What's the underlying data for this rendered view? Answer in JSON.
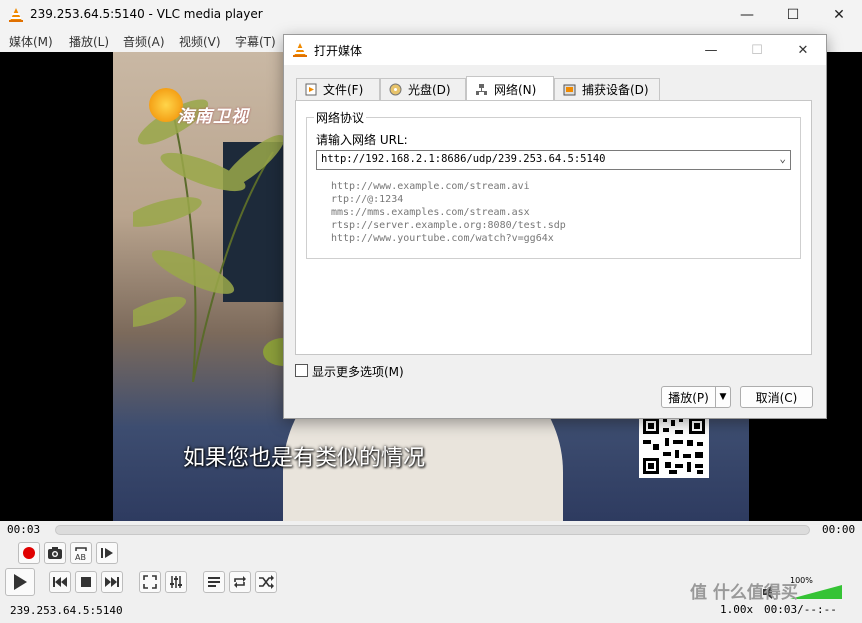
{
  "window": {
    "title": "239.253.64.5:5140 - VLC media player",
    "minimize_glyph": "—",
    "maximize_glyph": "☐",
    "close_glyph": "✕"
  },
  "menu": [
    {
      "label": "媒体(M)"
    },
    {
      "label": "播放(L)"
    },
    {
      "label": "音频(A)"
    },
    {
      "label": "视频(V)"
    },
    {
      "label": "字幕(T)"
    }
  ],
  "video": {
    "channel_logo": "海南卫视",
    "subtitle": "如果您也是有类似的情况"
  },
  "seek": {
    "elapsed": "00:03",
    "total": "00:00",
    "progress": 0
  },
  "status": {
    "source": "239.253.64.5:5140",
    "speed": "1.00x",
    "times": "00:03/--:--",
    "volume_percent": "100%"
  },
  "dialog": {
    "title": "打开媒体",
    "tabs": [
      {
        "label": "文件(F)",
        "icon": "file-icon"
      },
      {
        "label": "光盘(D)",
        "icon": "disc-icon"
      },
      {
        "label": "网络(N)",
        "icon": "network-icon",
        "active": true
      },
      {
        "label": "捕获设备(D)",
        "icon": "capture-device-icon"
      }
    ],
    "group_label": "网络协议",
    "url_label": "请输入网络 URL:",
    "url_value": "http://192.168.2.1:8686/udp/239.253.64.5:5140",
    "examples": [
      "http://www.example.com/stream.avi",
      "rtp://@:1234",
      "mms://mms.examples.com/stream.asx",
      "rtsp://server.example.org:8080/test.sdp",
      "http://www.yourtube.com/watch?v=gg64x"
    ],
    "more_options_label": "显示更多选项(M)",
    "more_options_checked": false,
    "play_label": "播放(P)",
    "cancel_label": "取消(C)"
  },
  "watermark": "值 什么值得买",
  "colors": {
    "vlc_orange": "#f08a00",
    "record_red": "#e00000",
    "volume_green": "#35c335"
  }
}
